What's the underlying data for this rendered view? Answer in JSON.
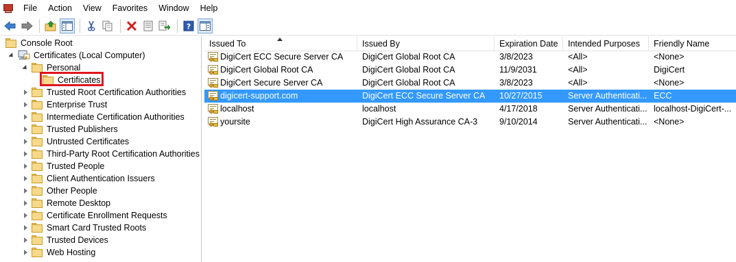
{
  "menu": [
    "File",
    "Action",
    "View",
    "Favorites",
    "Window",
    "Help"
  ],
  "toolbar_icons": [
    "back-icon",
    "forward-icon",
    "up-folder-icon",
    "show-hide-tree-icon",
    "cut-icon",
    "copy-icon",
    "delete-icon",
    "properties-icon",
    "export-list-icon",
    "help-icon",
    "show-hide-action-pane-icon"
  ],
  "tree": {
    "root": "Console Root",
    "computer": "Certificates (Local Computer)",
    "personal": "Personal",
    "certificates": "Certificates",
    "stores": [
      "Trusted Root Certification Authorities",
      "Enterprise Trust",
      "Intermediate Certification Authorities",
      "Trusted Publishers",
      "Untrusted Certificates",
      "Third-Party Root Certification Authorities",
      "Trusted People",
      "Client Authentication Issuers",
      "Other People",
      "Remote Desktop",
      "Certificate Enrollment Requests",
      "Smart Card Trusted Roots",
      "Trusted Devices",
      "Web Hosting"
    ]
  },
  "list": {
    "columns": [
      "Issued To",
      "Issued By",
      "Expiration Date",
      "Intended Purposes",
      "Friendly Name"
    ],
    "rows": [
      [
        "DigiCert ECC Secure Server CA",
        "DigiCert Global Root CA",
        "3/8/2023",
        "<All>",
        "<None>"
      ],
      [
        "DigiCert Global Root CA",
        "DigiCert Global Root CA",
        "11/9/2031",
        "<All>",
        "DigiCert"
      ],
      [
        "DigiCert Secure Server CA",
        "DigiCert Global Root CA",
        "3/8/2023",
        "<All>",
        "<None>"
      ],
      [
        "digicert-support.com",
        "DigiCert ECC Secure Server CA",
        "10/27/2015",
        "Server Authenticati...",
        "ECC"
      ],
      [
        "localhost",
        "localhost",
        "4/17/2018",
        "Server Authenticati...",
        "localhost-DigiCert-..."
      ],
      [
        "yoursite",
        "DigiCert High Assurance CA-3",
        "9/10/2014",
        "Server Authenticati...",
        "<None>"
      ]
    ],
    "selected_row": 3
  },
  "colors": {
    "selection": "#3399ff",
    "highlight_box": "#e0141e"
  }
}
